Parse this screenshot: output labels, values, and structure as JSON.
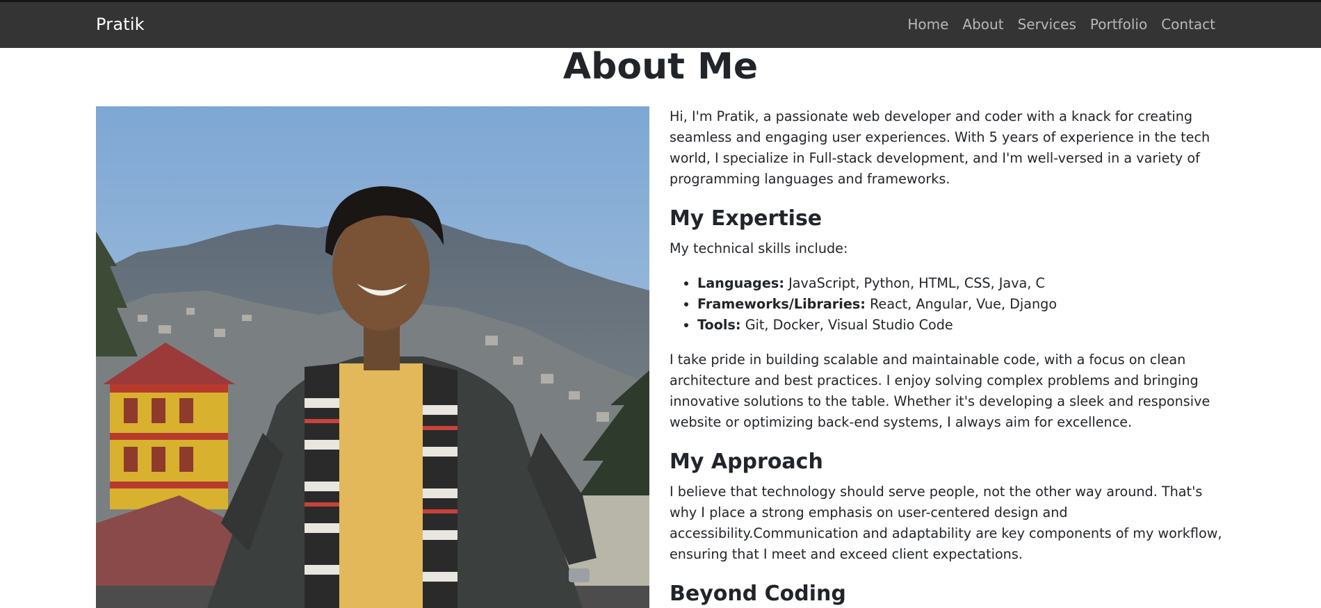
{
  "navbar": {
    "brand": "Pratik",
    "links": [
      "Home",
      "About",
      "Services",
      "Portfolio",
      "Contact"
    ]
  },
  "page": {
    "title": "About Me"
  },
  "about": {
    "intro": "Hi, I'm Pratik, a passionate web developer and coder with a knack for creating seamless and engaging user experiences. With 5 years of experience in the tech world, I specialize in Full-stack development, and I'm well-versed in a variety of programming languages and frameworks.",
    "expertise_heading": "My Expertise",
    "skills_intro": "My technical skills include:",
    "skills": [
      {
        "label": "Languages:",
        "value": "JavaScript, Python, HTML, CSS, Java, C"
      },
      {
        "label": "Frameworks/Libraries:",
        "value": "React, Angular, Vue, Django"
      },
      {
        "label": "Tools:",
        "value": "Git, Docker, Visual Studio Code"
      }
    ],
    "pride": "I take pride in building scalable and maintainable code, with a focus on clean architecture and best practices. I enjoy solving complex problems and bringing innovative solutions to the table. Whether it's developing a sleek and responsive website or optimizing back-end systems, I always aim for excellence.",
    "approach_heading": "My Approach",
    "approach": "I believe that technology should serve people, not the other way around. That's why I place a strong emphasis on user-centered design and accessibility.Communication and adaptability are key components of my workflow, ensuring that I meet and exceed client expectations.",
    "beyond_heading": "Beyond Coding"
  },
  "colors": {
    "navbar_bg": "#343434",
    "brand": "#ffffff",
    "nav_link": "#b8b8b8",
    "text": "#212529"
  }
}
